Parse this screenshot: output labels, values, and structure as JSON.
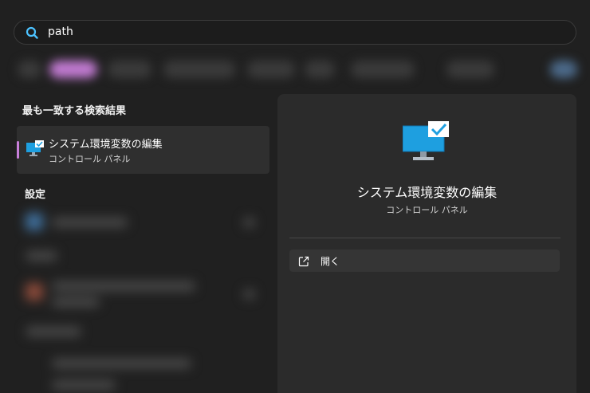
{
  "search": {
    "query": "path"
  },
  "sections": {
    "best_match": "最も一致する検索結果",
    "settings": "設定"
  },
  "best_match_item": {
    "title": "システム環境変数の編集",
    "subtitle": "コントロール パネル",
    "icon": "monitor-check-icon"
  },
  "detail": {
    "title": "システム環境変数の編集",
    "subtitle": "コントロール パネル",
    "icon": "monitor-check-icon",
    "actions": [
      {
        "label": "開く",
        "icon": "open-external-icon"
      }
    ]
  },
  "colors": {
    "background": "#202020",
    "panel": "#2b2b2b",
    "accent": "#c87fda",
    "monitor": "#1e9fe0"
  }
}
